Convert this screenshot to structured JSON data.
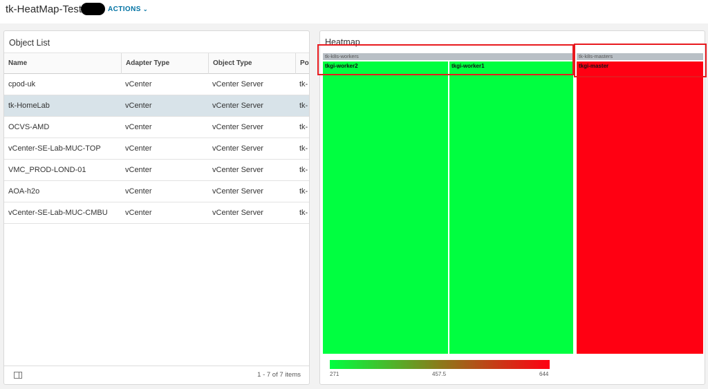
{
  "header": {
    "title": "tk-HeatMap-Test",
    "actions_label": "ACTIONS"
  },
  "object_list": {
    "title": "Object List",
    "columns": [
      "Name",
      "Adapter Type",
      "Object Type",
      "Pol"
    ],
    "rows": [
      {
        "name": "cpod-uk",
        "adapter": "vCenter",
        "object_type": "vCenter Server",
        "pol": "tk-"
      },
      {
        "name": "tk-HomeLab",
        "adapter": "vCenter",
        "object_type": "vCenter Server",
        "pol": "tk-"
      },
      {
        "name": "OCVS-AMD",
        "adapter": "vCenter",
        "object_type": "vCenter Server",
        "pol": "tk-"
      },
      {
        "name": "vCenter-SE-Lab-MUC-TOP",
        "adapter": "vCenter",
        "object_type": "vCenter Server",
        "pol": "tk-"
      },
      {
        "name": "VMC_PROD-LOND-01",
        "adapter": "vCenter",
        "object_type": "vCenter Server",
        "pol": "tk-"
      },
      {
        "name": "AOA-h2o",
        "adapter": "vCenter",
        "object_type": "vCenter Server",
        "pol": "tk-"
      },
      {
        "name": "vCenter-SE-Lab-MUC-CMBU",
        "adapter": "vCenter",
        "object_type": "vCenter Server",
        "pol": "tk-"
      }
    ],
    "selected_index": 1,
    "pager_text": "1 - 7 of 7 items"
  },
  "heatmap": {
    "title": "Heatmap",
    "groups": [
      {
        "label": "tk-k8s-workers",
        "tiles": [
          {
            "label": "tkgi-worker2",
            "color": "#00ff40"
          },
          {
            "label": "tkgi-worker1",
            "color": "#00ff40"
          }
        ]
      },
      {
        "label": "tk-k8s-masters",
        "tiles": [
          {
            "label": "tkgi-master",
            "color": "#ff0012"
          }
        ]
      }
    ],
    "legend": {
      "min": "271",
      "mid": "457.5",
      "max": "644",
      "color_low": "#00ff40",
      "color_mid": "#8b7a1a",
      "color_high": "#ff0012"
    },
    "highlight_color": "#e8191e"
  }
}
